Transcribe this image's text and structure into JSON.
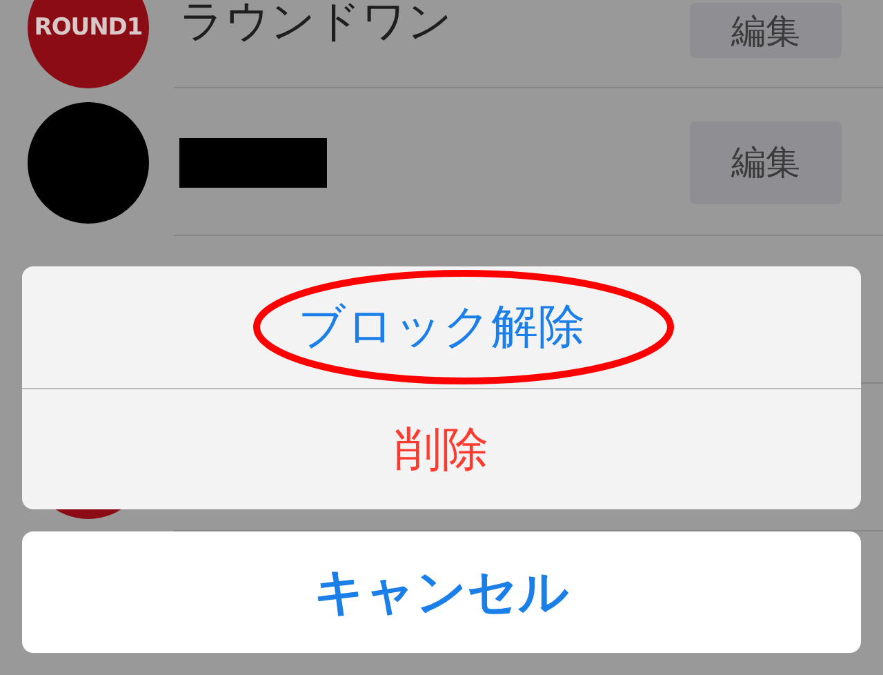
{
  "contacts": [
    {
      "avatar": {
        "kind": "logo",
        "text": "ROUND1",
        "color": "#8b0c14"
      },
      "name": "ラウンドワン",
      "redacted": false,
      "edit_label": "編集"
    },
    {
      "avatar": {
        "kind": "plain",
        "color": "#000000"
      },
      "redacted": true,
      "edit_label": "編集"
    },
    {
      "avatar": {
        "kind": "hidden"
      },
      "redacted": false
    },
    {
      "avatar": {
        "kind": "plain",
        "color": "#8b0c14"
      },
      "redacted": false
    }
  ],
  "action_sheet": {
    "actions": [
      {
        "label": "ブロック解除",
        "kind": "default",
        "highlighted": true
      },
      {
        "label": "削除",
        "kind": "destructive",
        "highlighted": false
      }
    ],
    "cancel": {
      "label": "キャンセル"
    }
  }
}
